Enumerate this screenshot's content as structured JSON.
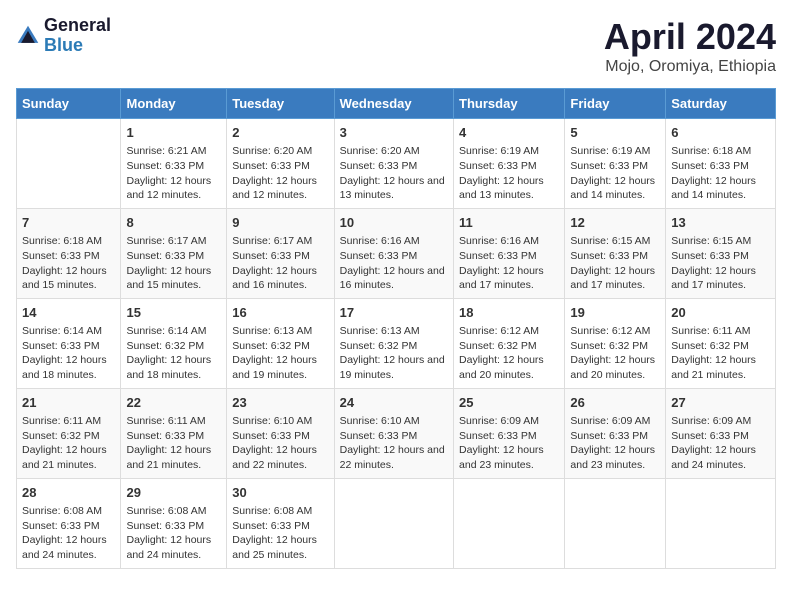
{
  "header": {
    "logo": {
      "general": "General",
      "blue": "Blue"
    },
    "title": "April 2024",
    "subtitle": "Mojo, Oromiya, Ethiopia"
  },
  "days_of_week": [
    "Sunday",
    "Monday",
    "Tuesday",
    "Wednesday",
    "Thursday",
    "Friday",
    "Saturday"
  ],
  "weeks": [
    [
      {
        "day": "",
        "sunrise": "",
        "sunset": "",
        "daylight": ""
      },
      {
        "day": "1",
        "sunrise": "Sunrise: 6:21 AM",
        "sunset": "Sunset: 6:33 PM",
        "daylight": "Daylight: 12 hours and 12 minutes."
      },
      {
        "day": "2",
        "sunrise": "Sunrise: 6:20 AM",
        "sunset": "Sunset: 6:33 PM",
        "daylight": "Daylight: 12 hours and 12 minutes."
      },
      {
        "day": "3",
        "sunrise": "Sunrise: 6:20 AM",
        "sunset": "Sunset: 6:33 PM",
        "daylight": "Daylight: 12 hours and 13 minutes."
      },
      {
        "day": "4",
        "sunrise": "Sunrise: 6:19 AM",
        "sunset": "Sunset: 6:33 PM",
        "daylight": "Daylight: 12 hours and 13 minutes."
      },
      {
        "day": "5",
        "sunrise": "Sunrise: 6:19 AM",
        "sunset": "Sunset: 6:33 PM",
        "daylight": "Daylight: 12 hours and 14 minutes."
      },
      {
        "day": "6",
        "sunrise": "Sunrise: 6:18 AM",
        "sunset": "Sunset: 6:33 PM",
        "daylight": "Daylight: 12 hours and 14 minutes."
      }
    ],
    [
      {
        "day": "7",
        "sunrise": "Sunrise: 6:18 AM",
        "sunset": "Sunset: 6:33 PM",
        "daylight": "Daylight: 12 hours and 15 minutes."
      },
      {
        "day": "8",
        "sunrise": "Sunrise: 6:17 AM",
        "sunset": "Sunset: 6:33 PM",
        "daylight": "Daylight: 12 hours and 15 minutes."
      },
      {
        "day": "9",
        "sunrise": "Sunrise: 6:17 AM",
        "sunset": "Sunset: 6:33 PM",
        "daylight": "Daylight: 12 hours and 16 minutes."
      },
      {
        "day": "10",
        "sunrise": "Sunrise: 6:16 AM",
        "sunset": "Sunset: 6:33 PM",
        "daylight": "Daylight: 12 hours and 16 minutes."
      },
      {
        "day": "11",
        "sunrise": "Sunrise: 6:16 AM",
        "sunset": "Sunset: 6:33 PM",
        "daylight": "Daylight: 12 hours and 17 minutes."
      },
      {
        "day": "12",
        "sunrise": "Sunrise: 6:15 AM",
        "sunset": "Sunset: 6:33 PM",
        "daylight": "Daylight: 12 hours and 17 minutes."
      },
      {
        "day": "13",
        "sunrise": "Sunrise: 6:15 AM",
        "sunset": "Sunset: 6:33 PM",
        "daylight": "Daylight: 12 hours and 17 minutes."
      }
    ],
    [
      {
        "day": "14",
        "sunrise": "Sunrise: 6:14 AM",
        "sunset": "Sunset: 6:33 PM",
        "daylight": "Daylight: 12 hours and 18 minutes."
      },
      {
        "day": "15",
        "sunrise": "Sunrise: 6:14 AM",
        "sunset": "Sunset: 6:32 PM",
        "daylight": "Daylight: 12 hours and 18 minutes."
      },
      {
        "day": "16",
        "sunrise": "Sunrise: 6:13 AM",
        "sunset": "Sunset: 6:32 PM",
        "daylight": "Daylight: 12 hours and 19 minutes."
      },
      {
        "day": "17",
        "sunrise": "Sunrise: 6:13 AM",
        "sunset": "Sunset: 6:32 PM",
        "daylight": "Daylight: 12 hours and 19 minutes."
      },
      {
        "day": "18",
        "sunrise": "Sunrise: 6:12 AM",
        "sunset": "Sunset: 6:32 PM",
        "daylight": "Daylight: 12 hours and 20 minutes."
      },
      {
        "day": "19",
        "sunrise": "Sunrise: 6:12 AM",
        "sunset": "Sunset: 6:32 PM",
        "daylight": "Daylight: 12 hours and 20 minutes."
      },
      {
        "day": "20",
        "sunrise": "Sunrise: 6:11 AM",
        "sunset": "Sunset: 6:32 PM",
        "daylight": "Daylight: 12 hours and 21 minutes."
      }
    ],
    [
      {
        "day": "21",
        "sunrise": "Sunrise: 6:11 AM",
        "sunset": "Sunset: 6:32 PM",
        "daylight": "Daylight: 12 hours and 21 minutes."
      },
      {
        "day": "22",
        "sunrise": "Sunrise: 6:11 AM",
        "sunset": "Sunset: 6:33 PM",
        "daylight": "Daylight: 12 hours and 21 minutes."
      },
      {
        "day": "23",
        "sunrise": "Sunrise: 6:10 AM",
        "sunset": "Sunset: 6:33 PM",
        "daylight": "Daylight: 12 hours and 22 minutes."
      },
      {
        "day": "24",
        "sunrise": "Sunrise: 6:10 AM",
        "sunset": "Sunset: 6:33 PM",
        "daylight": "Daylight: 12 hours and 22 minutes."
      },
      {
        "day": "25",
        "sunrise": "Sunrise: 6:09 AM",
        "sunset": "Sunset: 6:33 PM",
        "daylight": "Daylight: 12 hours and 23 minutes."
      },
      {
        "day": "26",
        "sunrise": "Sunrise: 6:09 AM",
        "sunset": "Sunset: 6:33 PM",
        "daylight": "Daylight: 12 hours and 23 minutes."
      },
      {
        "day": "27",
        "sunrise": "Sunrise: 6:09 AM",
        "sunset": "Sunset: 6:33 PM",
        "daylight": "Daylight: 12 hours and 24 minutes."
      }
    ],
    [
      {
        "day": "28",
        "sunrise": "Sunrise: 6:08 AM",
        "sunset": "Sunset: 6:33 PM",
        "daylight": "Daylight: 12 hours and 24 minutes."
      },
      {
        "day": "29",
        "sunrise": "Sunrise: 6:08 AM",
        "sunset": "Sunset: 6:33 PM",
        "daylight": "Daylight: 12 hours and 24 minutes."
      },
      {
        "day": "30",
        "sunrise": "Sunrise: 6:08 AM",
        "sunset": "Sunset: 6:33 PM",
        "daylight": "Daylight: 12 hours and 25 minutes."
      },
      {
        "day": "",
        "sunrise": "",
        "sunset": "",
        "daylight": ""
      },
      {
        "day": "",
        "sunrise": "",
        "sunset": "",
        "daylight": ""
      },
      {
        "day": "",
        "sunrise": "",
        "sunset": "",
        "daylight": ""
      },
      {
        "day": "",
        "sunrise": "",
        "sunset": "",
        "daylight": ""
      }
    ]
  ]
}
